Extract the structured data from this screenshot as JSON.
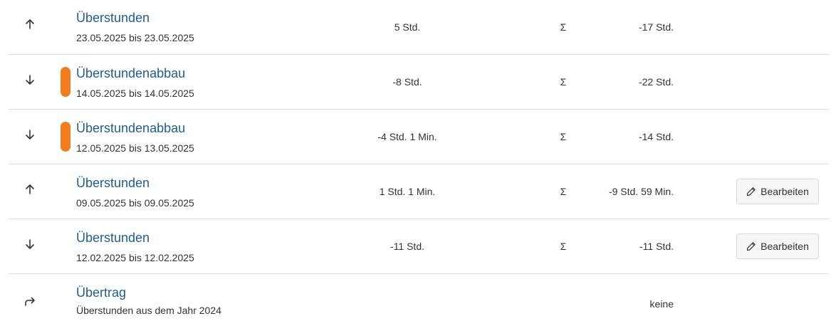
{
  "entries": [
    {
      "direction_icon": "arrow-up-icon",
      "marker": false,
      "title": "Überstunden",
      "period": "23.05.2025 bis 23.05.2025",
      "amount": "5 Std.",
      "sigma": "Σ",
      "total": "-17 Std.",
      "edit_label": null
    },
    {
      "direction_icon": "arrow-down-icon",
      "marker": true,
      "marker_color": "#f47c20",
      "title": "Überstundenabbau",
      "period": "14.05.2025 bis 14.05.2025",
      "amount": "-8 Std.",
      "sigma": "Σ",
      "total": "-22 Std.",
      "edit_label": null
    },
    {
      "direction_icon": "arrow-down-icon",
      "marker": true,
      "marker_color": "#f47c20",
      "title": "Überstundenabbau",
      "period": "12.05.2025 bis 13.05.2025",
      "amount": "-4 Std. 1 Min.",
      "sigma": "Σ",
      "total": "-14 Std.",
      "edit_label": null
    },
    {
      "direction_icon": "arrow-up-icon",
      "marker": false,
      "title": "Überstunden",
      "period": "09.05.2025 bis 09.05.2025",
      "amount": "1 Std. 1 Min.",
      "sigma": "Σ",
      "total": "-9 Std. 59 Min.",
      "edit_label": "Bearbeiten"
    },
    {
      "direction_icon": "arrow-down-icon",
      "marker": false,
      "title": "Überstunden",
      "period": "12.02.2025 bis 12.02.2025",
      "amount": "-11 Std.",
      "sigma": "Σ",
      "total": "-11 Std.",
      "edit_label": "Bearbeiten"
    },
    {
      "direction_icon": "carry-forward-icon",
      "marker": false,
      "title": "Übertrag",
      "period": "Überstunden aus dem Jahr 2024",
      "amount": "",
      "sigma": "",
      "total": "keine",
      "edit_label": null
    }
  ]
}
